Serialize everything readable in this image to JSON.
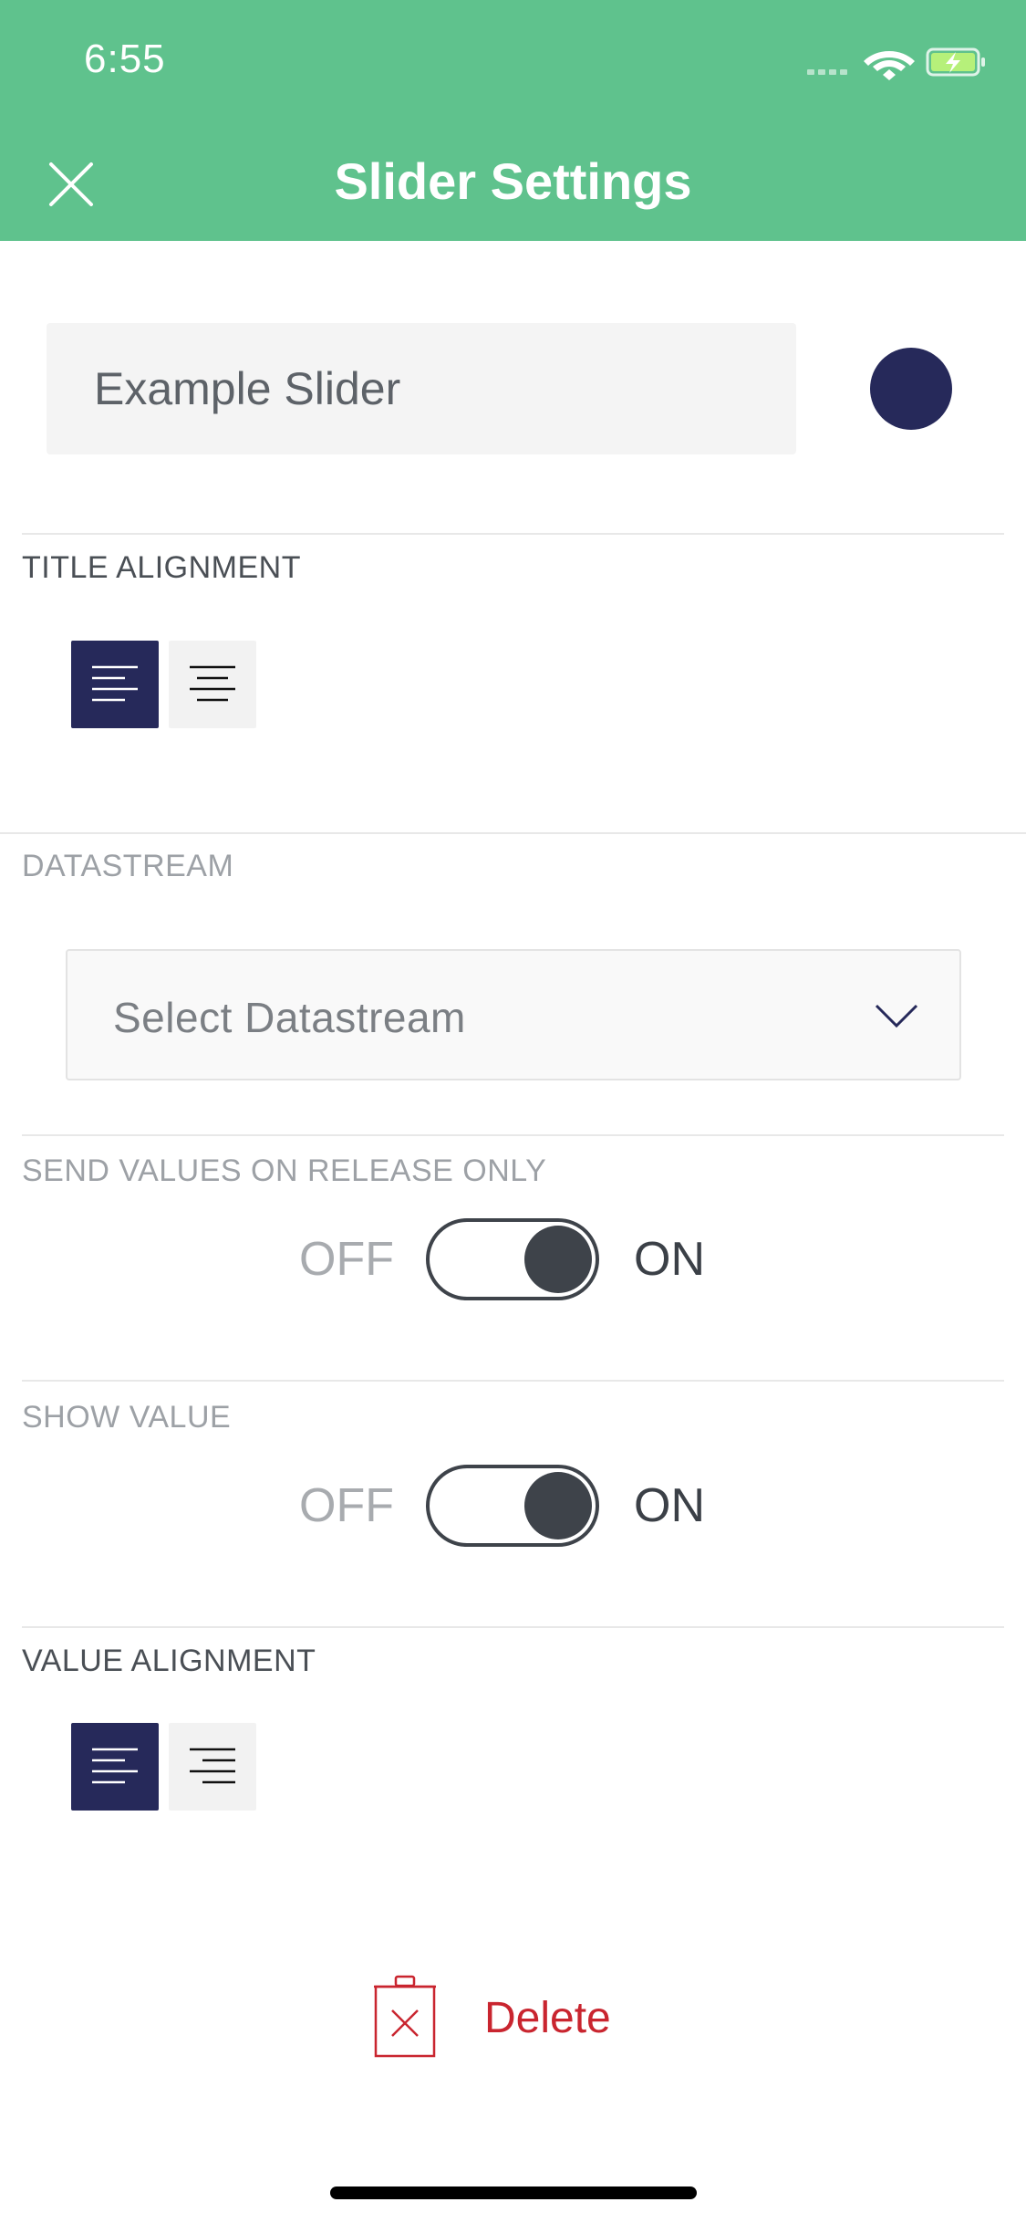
{
  "status_bar": {
    "time": "6:55"
  },
  "header": {
    "title": "Slider Settings"
  },
  "widget": {
    "title_value": "Example Slider",
    "color": "#26295a"
  },
  "title_alignment": {
    "label": "TITLE ALIGNMENT",
    "options": [
      "left",
      "center"
    ],
    "selected": "left"
  },
  "datastream": {
    "label": "DATASTREAM",
    "placeholder": "Select Datastream"
  },
  "send_on_release": {
    "label": "SEND VALUES ON RELEASE ONLY",
    "off_label": "OFF",
    "on_label": "ON",
    "value": "on"
  },
  "show_value": {
    "label": "SHOW VALUE",
    "off_label": "OFF",
    "on_label": "ON",
    "value": "on"
  },
  "value_alignment": {
    "label": "VALUE ALIGNMENT",
    "options": [
      "left",
      "right"
    ],
    "selected": "left"
  },
  "delete": {
    "label": "Delete"
  },
  "colors": {
    "header": "#5fc28d",
    "accent": "#26295a",
    "danger": "#c9252f"
  }
}
